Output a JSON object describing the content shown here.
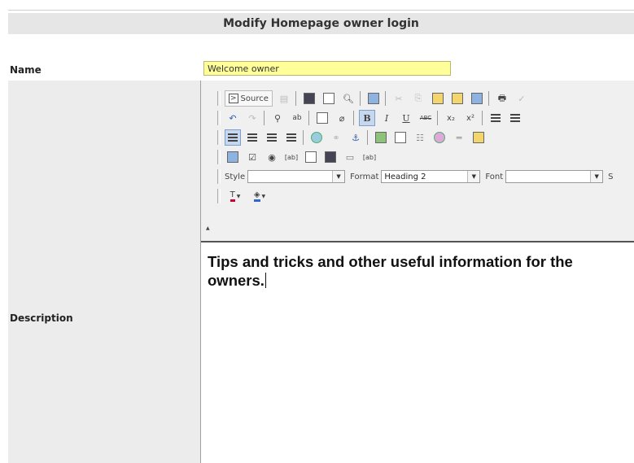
{
  "page": {
    "title": "Modify Homepage owner login"
  },
  "form": {
    "name_label": "Name",
    "name_value": "Welcome owner",
    "description_label": "Description"
  },
  "editor": {
    "toolbar": {
      "source_label": "Source",
      "bold_label": "B",
      "italic_label": "I",
      "underline_label": "U",
      "strike_label": "ABC",
      "style_label": "Style",
      "style_value": "",
      "format_label": "Format",
      "format_value": "Heading 2",
      "font_label": "Font",
      "font_value": "",
      "size_label_partial": "S"
    },
    "content": "Tips and tricks and other useful information for the owners."
  }
}
